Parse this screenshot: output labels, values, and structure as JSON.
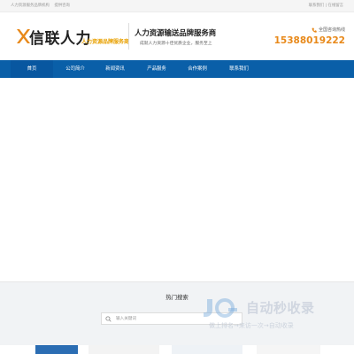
{
  "topbar": {
    "left_items": [
      "人力资源服务品牌机构",
      "提供咨询"
    ],
    "right_text": "联系我们 | 在线留言"
  },
  "header": {
    "logo_text": "信联人力",
    "logo_slogan": "人力资源品牌服务商",
    "tagline": "人力资源输送品牌服务商",
    "subline": "成就人力资源十佳优质企业，服务至上",
    "phone_label": "全国咨询热线",
    "phone_number": "15388019222"
  },
  "nav": {
    "items": [
      {
        "label": "首页"
      },
      {
        "label": "公司简介"
      },
      {
        "label": "新闻资讯"
      },
      {
        "label": "产品服务"
      },
      {
        "label": "合作案例"
      },
      {
        "label": "联系我们"
      }
    ]
  },
  "search": {
    "title": "热门搜索",
    "placeholder": "输入关键词"
  },
  "watermark": {
    "brand": "自动秒收录",
    "sub": "做上排名→来访一次→自动收录"
  },
  "colors": {
    "nav_bg": "#0a5fa8",
    "accent_orange": "#e8891a",
    "slogan_orange": "#e8a000",
    "band_bg": "#f1f3f5"
  }
}
